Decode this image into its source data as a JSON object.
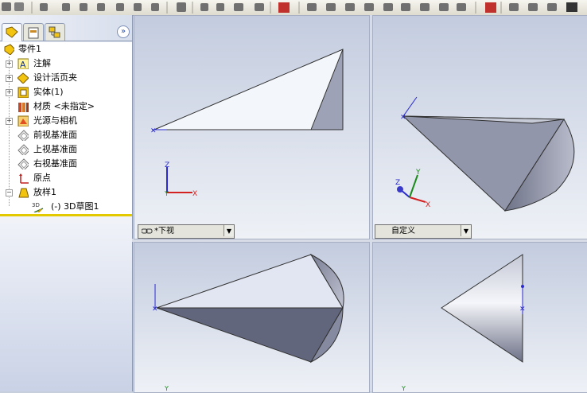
{
  "window": {
    "feature_tree": {
      "collapse_glyph": "»",
      "items": [
        {
          "label": "零件1",
          "icon": "part-icon"
        },
        {
          "label": "注解",
          "icon": "annotation-icon"
        },
        {
          "label": "设计活页夹",
          "icon": "design-binder-icon"
        },
        {
          "label": "实体(1)",
          "icon": "solid-body-icon"
        },
        {
          "label": "材质 <未指定>",
          "icon": "material-icon"
        },
        {
          "label": "光源与相机",
          "icon": "lights-camera-icon"
        },
        {
          "label": "前视基准面",
          "icon": "plane-icon"
        },
        {
          "label": "上视基准面",
          "icon": "plane-icon"
        },
        {
          "label": "右视基准面",
          "icon": "plane-icon"
        },
        {
          "label": "原点",
          "icon": "origin-icon"
        },
        {
          "label": "放样1",
          "icon": "loft-icon"
        },
        {
          "label": "(-) 3D草图1",
          "icon": "3d-sketch-icon",
          "badge": "3D"
        }
      ]
    },
    "viewports": {
      "top_left": {
        "view_name": "*下视"
      },
      "top_right": {
        "view_name": "自定义"
      }
    },
    "axis_labels": {
      "x": "X",
      "y": "Y",
      "z": "Z"
    },
    "colors": {
      "accent": "#2a4b9a",
      "tree_divider": "#e3c900",
      "axis_x": "#d32020",
      "axis_y": "#1a8a1a",
      "axis_z": "#2a2ad0"
    }
  }
}
